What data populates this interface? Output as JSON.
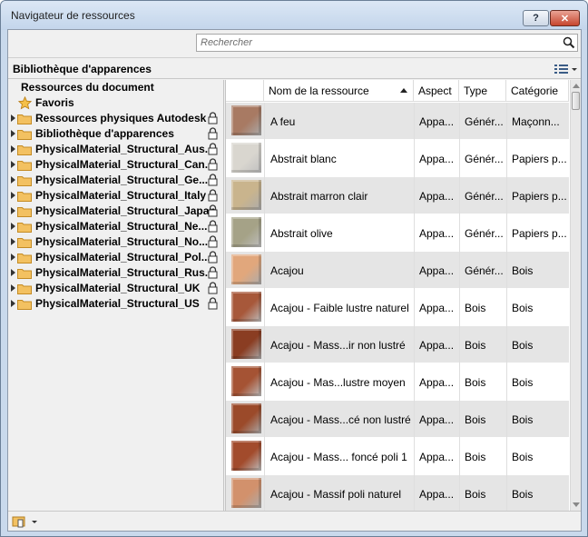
{
  "window": {
    "title": "Navigateur de ressources",
    "help_label": "?",
    "close_label": "✕"
  },
  "search": {
    "placeholder": "Rechercher",
    "value": ""
  },
  "library_header": {
    "title": "Bibliothèque d'apparences"
  },
  "tree": {
    "document_resources": "Ressources du document",
    "favorites": "Favoris",
    "items": [
      {
        "label": "Ressources physiques Autodesk"
      },
      {
        "label": "Bibliothèque d'apparences"
      },
      {
        "label": "PhysicalMaterial_Structural_Aus..."
      },
      {
        "label": "PhysicalMaterial_Structural_Can..."
      },
      {
        "label": "PhysicalMaterial_Structural_Ge..."
      },
      {
        "label": "PhysicalMaterial_Structural_Italy"
      },
      {
        "label": "PhysicalMaterial_Structural_Japan"
      },
      {
        "label": "PhysicalMaterial_Structural_Ne..."
      },
      {
        "label": "PhysicalMaterial_Structural_No..."
      },
      {
        "label": "PhysicalMaterial_Structural_Pol..."
      },
      {
        "label": "PhysicalMaterial_Structural_Rus..."
      },
      {
        "label": "PhysicalMaterial_Structural_UK"
      },
      {
        "label": "PhysicalMaterial_Structural_US"
      }
    ]
  },
  "grid": {
    "columns": [
      "Nom de la ressource",
      "Aspect",
      "Type",
      "Catégorie"
    ],
    "rows": [
      {
        "name": "A feu",
        "aspect": "Appa...",
        "type": "Génér...",
        "category": "Maçonn...",
        "swatch": "#a87a63"
      },
      {
        "name": "Abstrait blanc",
        "aspect": "Appa...",
        "type": "Génér...",
        "category": "Papiers p...",
        "swatch": "#d9d6cf"
      },
      {
        "name": "Abstrait marron clair",
        "aspect": "Appa...",
        "type": "Génér...",
        "category": "Papiers p...",
        "swatch": "#c9b48d"
      },
      {
        "name": "Abstrait olive",
        "aspect": "Appa...",
        "type": "Génér...",
        "category": "Papiers p...",
        "swatch": "#a5a287"
      },
      {
        "name": "Acajou",
        "aspect": "Appa...",
        "type": "Génér...",
        "category": "Bois",
        "swatch": "#e1a77c"
      },
      {
        "name": "Acajou - Faible lustre naturel",
        "aspect": "Appa...",
        "type": "Bois",
        "category": "Bois",
        "swatch": "#a7583a"
      },
      {
        "name": "Acajou - Mass...ir non lustré",
        "aspect": "Appa...",
        "type": "Bois",
        "category": "Bois",
        "swatch": "#8a3d22"
      },
      {
        "name": "Acajou - Mas...lustre moyen",
        "aspect": "Appa...",
        "type": "Bois",
        "category": "Bois",
        "swatch": "#a55334"
      },
      {
        "name": "Acajou - Mass...cé non lustré",
        "aspect": "Appa...",
        "type": "Bois",
        "category": "Bois",
        "swatch": "#9b4a2a"
      },
      {
        "name": "Acajou - Mass... foncé poli 1",
        "aspect": "Appa...",
        "type": "Bois",
        "category": "Bois",
        "swatch": "#a24b2c"
      },
      {
        "name": "Acajou - Massif poli naturel",
        "aspect": "Appa...",
        "type": "Bois",
        "category": "Bois",
        "swatch": "#d2916c"
      }
    ]
  }
}
